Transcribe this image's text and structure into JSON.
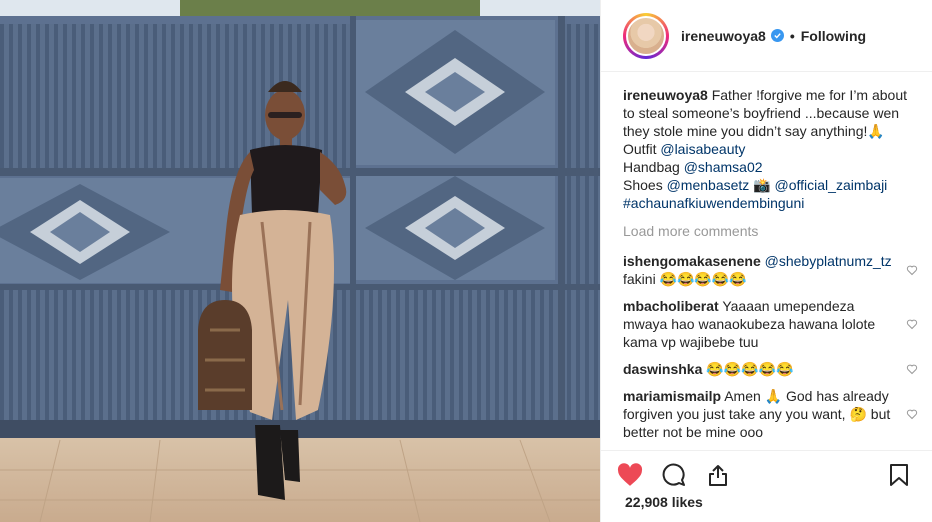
{
  "post": {
    "photo_alt": "",
    "colors": {
      "accent_red": "#ed4956",
      "link_blue": "#003569",
      "muted": "#999999",
      "verified_blue": "#3897f0"
    }
  },
  "header": {
    "username": "ireneuwoya8",
    "dot": "•",
    "follow_state": "Following"
  },
  "caption": {
    "username": "ireneuwoya8",
    "text": "Father !forgive me for I’m about to steal someone’s boyfriend ...because wen they stole mine you didn’t say anything!🙏",
    "outfit_label": "Outfit",
    "outfit_tag": "@laisabeauty",
    "handbag_label": "Handbag",
    "handbag_tag": "@shamsa02",
    "shoes_label": "Shoes",
    "shoes_tag1": "@menbasetz",
    "camera_emoji": "📸",
    "shoes_tag2": "@official_zaimbaji",
    "hashtag": "#achaunafkiuwendembinguni"
  },
  "load_more": "Load more comments",
  "comments": [
    {
      "user": "ishengomakasenene",
      "mention": "@shebyplatnumz_tz",
      "text": "fakini 😂😂😂😂😂"
    },
    {
      "user": "mbacholiberat",
      "mention": "",
      "text": "Yaaaan umependeza mwaya hao wanaokubeza hawana lolote kama vp wajibebe tuu"
    },
    {
      "user": "daswinshka",
      "mention": "",
      "text": "😂😂😂😂😂"
    },
    {
      "user": "mariamismailp",
      "mention": "",
      "text": "Amen 🙏 God has already forgiven you just take any you want, 🤔 but better not be mine ooo"
    }
  ],
  "actions": {
    "like_icon": "heart-filled-icon",
    "comment_icon": "comment-icon",
    "share_icon": "share-icon",
    "save_icon": "bookmark-icon"
  },
  "likes": "22,908 likes"
}
